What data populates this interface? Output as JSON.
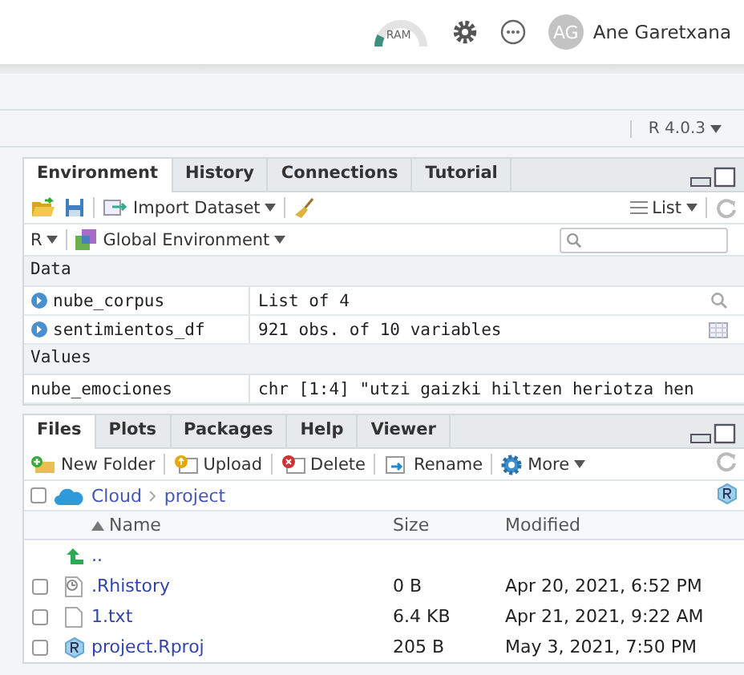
{
  "header": {
    "ram": {
      "label": "RAM",
      "level": 0.15
    },
    "user": {
      "initials": "AG",
      "name": "Ane Garetxana"
    }
  },
  "version_menu": {
    "label": "R 4.0.3"
  },
  "environment_pane": {
    "tabs": [
      {
        "label": "Environment",
        "selected": true
      },
      {
        "label": "History",
        "selected": false
      },
      {
        "label": "Connections",
        "selected": false
      },
      {
        "label": "Tutorial",
        "selected": false
      }
    ],
    "toolbar": {
      "import": "Import Dataset",
      "view": "List"
    },
    "language": "R",
    "scope": "Global Environment",
    "sections": [
      {
        "title": "Data",
        "rows": [
          {
            "name": "nube_corpus",
            "value": "List of  4",
            "kind": "list"
          },
          {
            "name": "sentimientos_df",
            "value": "921 obs. of 10 variables",
            "kind": "table"
          }
        ]
      },
      {
        "title": "Values",
        "rows": [
          {
            "name": "nube_emociones",
            "value": "chr [1:4] \"utzi gaizki hiltzen heriotza hen",
            "kind": "value"
          }
        ]
      }
    ]
  },
  "files_pane": {
    "tabs": [
      {
        "label": "Files",
        "selected": true
      },
      {
        "label": "Plots",
        "selected": false
      },
      {
        "label": "Packages",
        "selected": false
      },
      {
        "label": "Help",
        "selected": false
      },
      {
        "label": "Viewer",
        "selected": false
      }
    ],
    "toolbar": [
      {
        "label": "New Folder",
        "kind": "new-folder"
      },
      {
        "label": "Upload",
        "kind": "upload"
      },
      {
        "label": "Delete",
        "kind": "delete"
      },
      {
        "label": "Rename",
        "kind": "rename"
      },
      {
        "label": "More",
        "kind": "more"
      }
    ],
    "select_all": {
      "checked": false
    },
    "path": [
      "Cloud",
      "project"
    ],
    "columns": [
      "Name",
      "Size",
      "Modified"
    ],
    "parent": "..",
    "files": [
      {
        "name": ".Rhistory",
        "size": "0 B",
        "modified": "Apr 20, 2021, 6:52 PM",
        "kind": "history",
        "checked": false
      },
      {
        "name": "1.txt",
        "size": "6.4 KB",
        "modified": "Apr 21, 2021, 9:22 AM",
        "kind": "text",
        "checked": false
      },
      {
        "name": "project.Rproj",
        "size": "205 B",
        "modified": "May 3, 2021, 7:50 PM",
        "kind": "project",
        "checked": false
      }
    ]
  }
}
